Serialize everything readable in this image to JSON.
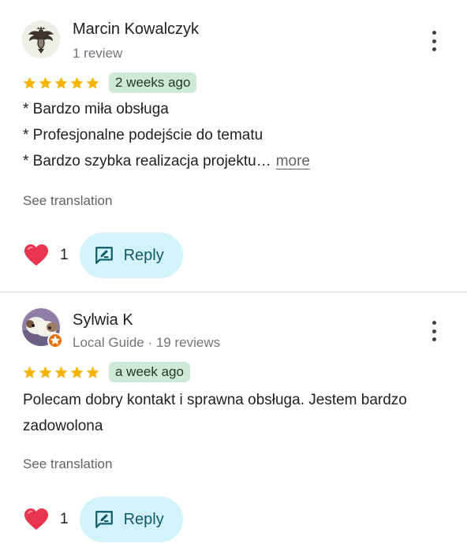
{
  "colors": {
    "star": "#f4b400",
    "date_chip_bg": "#ceead6",
    "reply_bg": "#d3f3fa",
    "reply_text": "#0f5a6a",
    "heart": "#e8344e",
    "local_guide_badge": "#e8710a"
  },
  "reviews": [
    {
      "author": "Marcin Kowalczyk",
      "subtitle": "1 review",
      "avatar_icon": "eagle-emblem-icon",
      "stars": 5,
      "date": "2 weeks ago",
      "lines": [
        "* Bardzo miła obsługa",
        "* Profesjonalne podejście do tematu",
        "* Bardzo szybka realizacja projektu…"
      ],
      "more_label": "more",
      "see_translation": "See translation",
      "likes": "1",
      "reply_label": "Reply"
    },
    {
      "author": "Sylwia K",
      "subtitle": "Local Guide · 19 reviews",
      "avatar_icon": "guinea-pig-photo-icon",
      "stars": 5,
      "date": "a week ago",
      "lines": [
        "Polecam dobry kontakt i sprawna obsługa. Jestem bardzo zadowolona"
      ],
      "see_translation": "See translation",
      "likes": "1",
      "reply_label": "Reply"
    }
  ]
}
